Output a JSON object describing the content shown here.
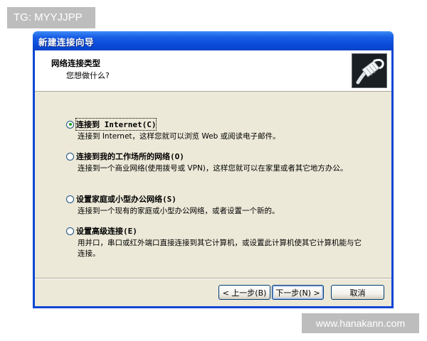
{
  "tag": "TG: MYYJJPP",
  "watermark": "www.hanakann.com",
  "window": {
    "title": "新建连接向导"
  },
  "header": {
    "title": "网络连接类型",
    "subtitle": "您想做什么?",
    "icon": "network-cable-icon"
  },
  "options": [
    {
      "label": "连接到 Internet(C)",
      "description": "连接到 Internet，这样您就可以浏览 Web 或阅读电子邮件。",
      "checked": true
    },
    {
      "label": "连接到我的工作场所的网络(O)",
      "description": "连接到一个商业网络(使用拨号或 VPN)，这样您就可以在家里或者其它地方办公。",
      "checked": false
    },
    {
      "label": "设置家庭或小型办公网络(S)",
      "description": "连接到一个现有的家庭或小型办公网络，或者设置一个新的。",
      "checked": false
    },
    {
      "label": "设置高级连接(E)",
      "description": "用并口，串口或红外端口直接连接到其它计算机，或设置此计算机使其它计算机能与它连接。",
      "checked": false
    }
  ],
  "buttons": {
    "back": "< 上一步(B)",
    "next": "下一步(N) >",
    "cancel": "取消"
  },
  "colors": {
    "titlebar": "#0a4ad8",
    "dialog_bg": "#ece9d8",
    "radio_dot": "#21a121"
  }
}
